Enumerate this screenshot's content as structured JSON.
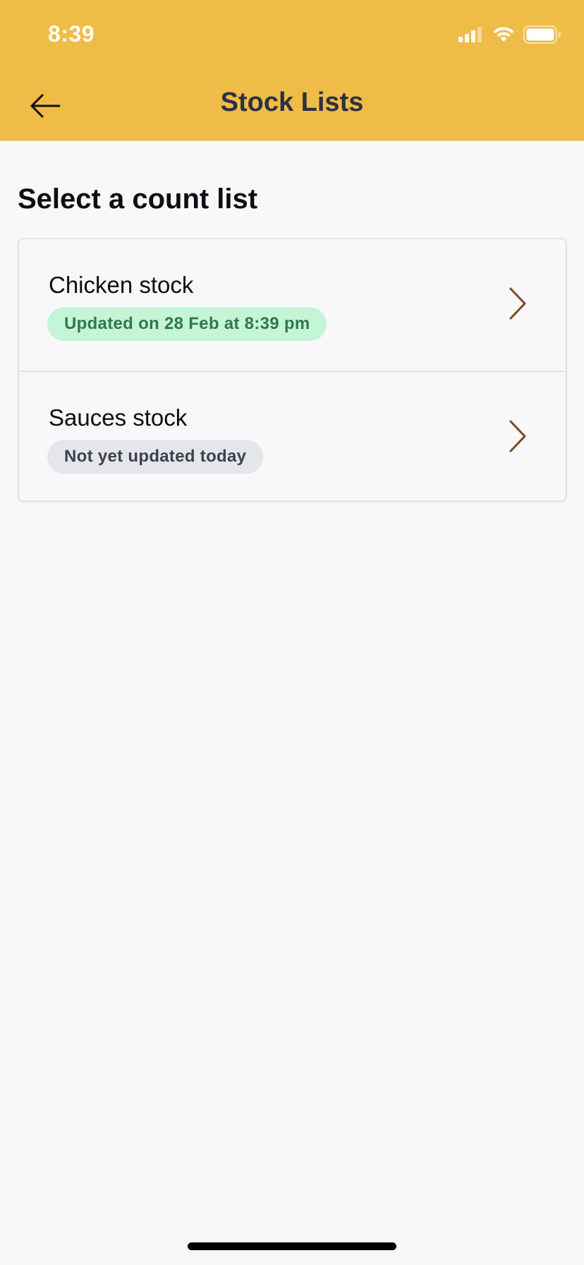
{
  "status_bar": {
    "time": "8:39",
    "icons": [
      "cellular-signal-icon",
      "wifi-icon",
      "battery-icon"
    ]
  },
  "header": {
    "title": "Stock Lists",
    "back_icon": "arrow-left-icon",
    "background_color": "#efbc46"
  },
  "main": {
    "heading": "Select a count list",
    "lists": [
      {
        "title": "Chicken stock",
        "status": "Updated on 28 Feb at 8:39 pm",
        "status_type": "updated",
        "status_color": "#c6f4d6"
      },
      {
        "title": "Sauces stock",
        "status": "Not yet updated today",
        "status_type": "pending",
        "status_color": "#e5e6ea"
      }
    ]
  },
  "colors": {
    "chevron": "#7a4a22",
    "background": "#f8f8fb"
  }
}
